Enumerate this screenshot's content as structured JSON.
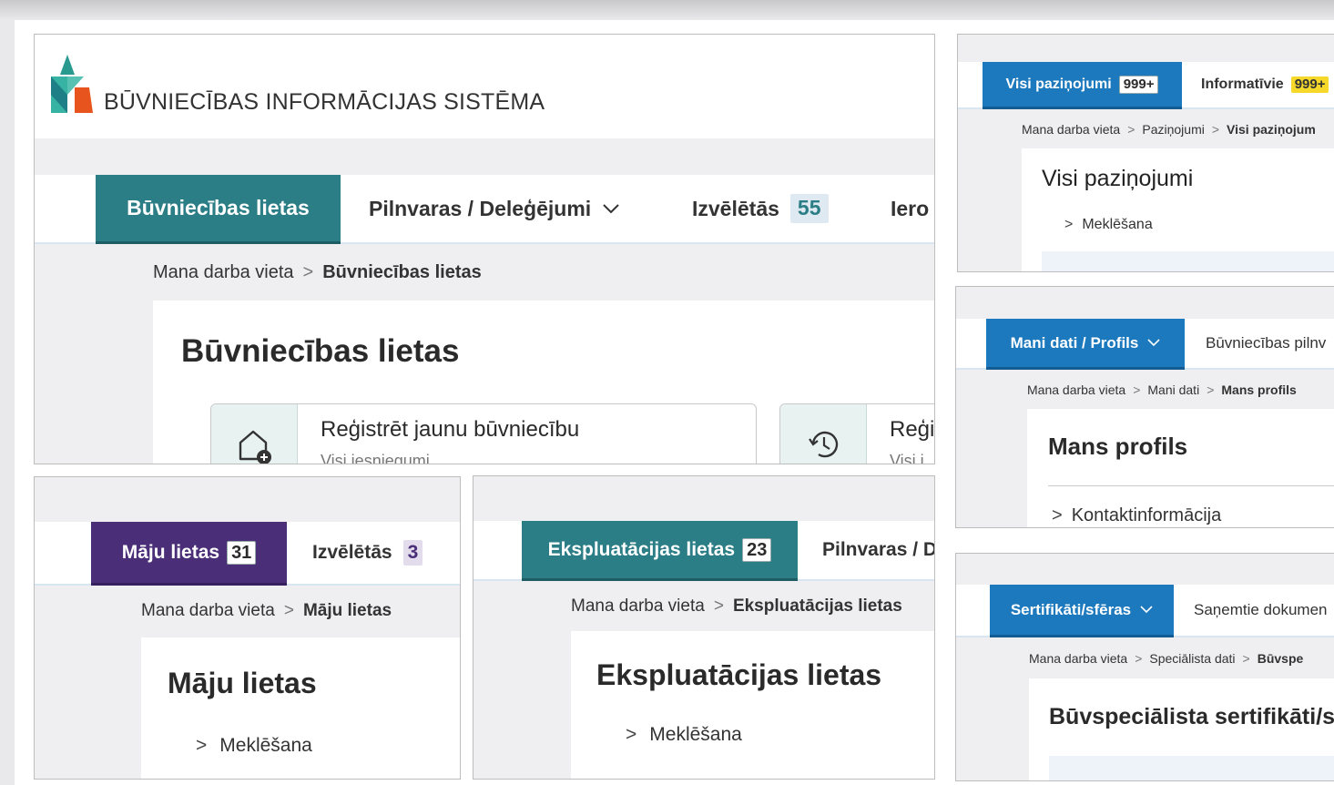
{
  "main": {
    "logo_text": "BŪVNIECĪBAS INFORMĀCIJAS SISTĒMA",
    "tabs": {
      "active": "Būvniecības lietas",
      "pilnvaras": "Pilnvaras / Deleģējumi",
      "izveletas": "Izvēlētās",
      "izveletas_count": "55",
      "cut": "Iero"
    },
    "breadcrumb": {
      "home": "Mana darba vieta",
      "current": "Būvniecības lietas"
    },
    "title": "Būvniecības lietas",
    "action_card": {
      "title": "Reģistrēt jaunu būvniecību",
      "subtitle": "Visi iesniegumi"
    },
    "action_card2": {
      "title": "Reģi",
      "subtitle": "Visi i"
    }
  },
  "maju": {
    "tab": "Māju lietas",
    "tab_count": "31",
    "izveletas": "Izvēlētās",
    "izveletas_count": "3",
    "breadcrumb": {
      "home": "Mana darba vieta",
      "current": "Māju lietas"
    },
    "title": "Māju lietas",
    "search": "Meklēšana"
  },
  "ekspl": {
    "tab": "Ekspluatācijas lietas",
    "tab_count": "23",
    "pilnvaras": "Pilnvaras / D",
    "breadcrumb": {
      "home": "Mana darba vieta",
      "current": "Ekspluatācijas lietas"
    },
    "title": "Ekspluatācijas lietas",
    "search": "Meklēšana"
  },
  "pazinojumi": {
    "tab": "Visi paziņojumi",
    "tab_count": "999+",
    "tab2": "Informatīvie",
    "tab2_count": "999+",
    "breadcrumb": {
      "home": "Mana darba vieta",
      "mid": "Paziņojumi",
      "current": "Visi paziņojum"
    },
    "title": "Visi paziņojumi",
    "search": "Meklēšana"
  },
  "profils": {
    "tab": "Mani dati / Profils",
    "tab2": "Būvniecības pilnv",
    "breadcrumb": {
      "home": "Mana darba vieta",
      "mid": "Mani dati",
      "current": "Mans profils"
    },
    "title": "Mans profils",
    "section": "Kontaktinformācija"
  },
  "sertifikati": {
    "tab": "Sertifikāti/sfēras",
    "tab2": "Saņemtie dokumen",
    "breadcrumb": {
      "home": "Mana darba vieta",
      "mid": "Speciālista dati",
      "current": "Būvspe"
    },
    "title": "Būvspeciālista sertifikāti/s"
  },
  "colors": {
    "teal": "#2b7e86",
    "purple": "#4a2f78",
    "blue": "#1d79bd",
    "badge_yellow": "#f5d82a",
    "logo_orange": "#e8541e"
  }
}
